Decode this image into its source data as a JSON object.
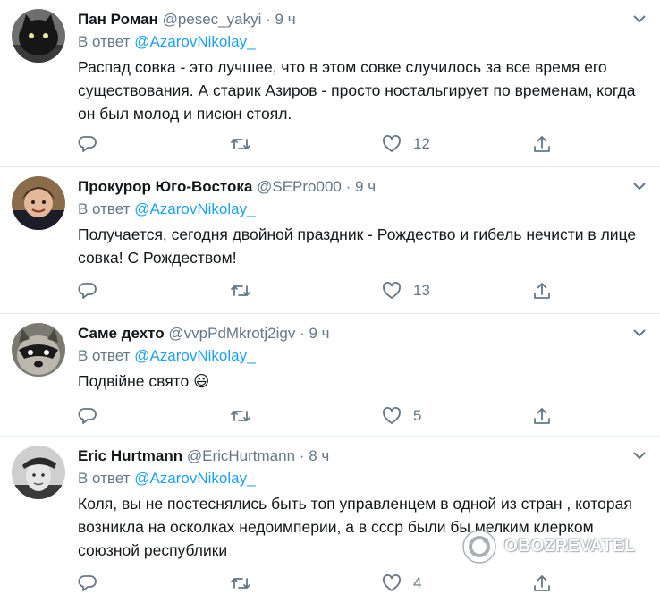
{
  "tweets": [
    {
      "name": "Пан Роман",
      "handle": "@pesec_yakyi",
      "time": "9 ч",
      "reply_prefix": "В ответ",
      "reply_to": "@AzarovNikolay_",
      "text": "Распад совка - это лучшее, что в этом совке случилось за все время его существования. А старик Азиров - просто ностальгирует по временам, когда он был молод и писюн стоял.",
      "likes": "12",
      "avatar": "black-cat-avatar"
    },
    {
      "name": "Прокурор Юго-Востока",
      "handle": "@SEPro000",
      "time": "9 ч",
      "reply_prefix": "В ответ",
      "reply_to": "@AzarovNikolay_",
      "text": "Получается, сегодня двойной праздник - Рождество и гибель нечисти в лице совка! С Рождеством!",
      "likes": "13",
      "avatar": "portrait-avatar"
    },
    {
      "name": "Саме дехто",
      "handle": "@vvpPdMkrotj2igv",
      "time": "9 ч",
      "reply_prefix": "В ответ",
      "reply_to": "@AzarovNikolay_",
      "text": "Подвійне свято",
      "emoji": "😃",
      "likes": "5",
      "avatar": "raccoon-avatar"
    },
    {
      "name": "Eric Hurtmann",
      "handle": "@EricHurtmann",
      "time": "8 ч",
      "reply_prefix": "В ответ",
      "reply_to": "@AzarovNikolay_",
      "text": "Коля, вы не постеснялись быть топ управленцем в одной из стран , которая возникла на осколках недоимперии, а в ссср были бы мелким клерком союзной республики",
      "likes": "4",
      "avatar": "bw-portrait-avatar"
    }
  ],
  "watermark": "OBOZREVATEL",
  "colors": {
    "link": "#1da1f2",
    "muted": "#657786",
    "text": "#14171a",
    "border": "#e6ecf0"
  }
}
